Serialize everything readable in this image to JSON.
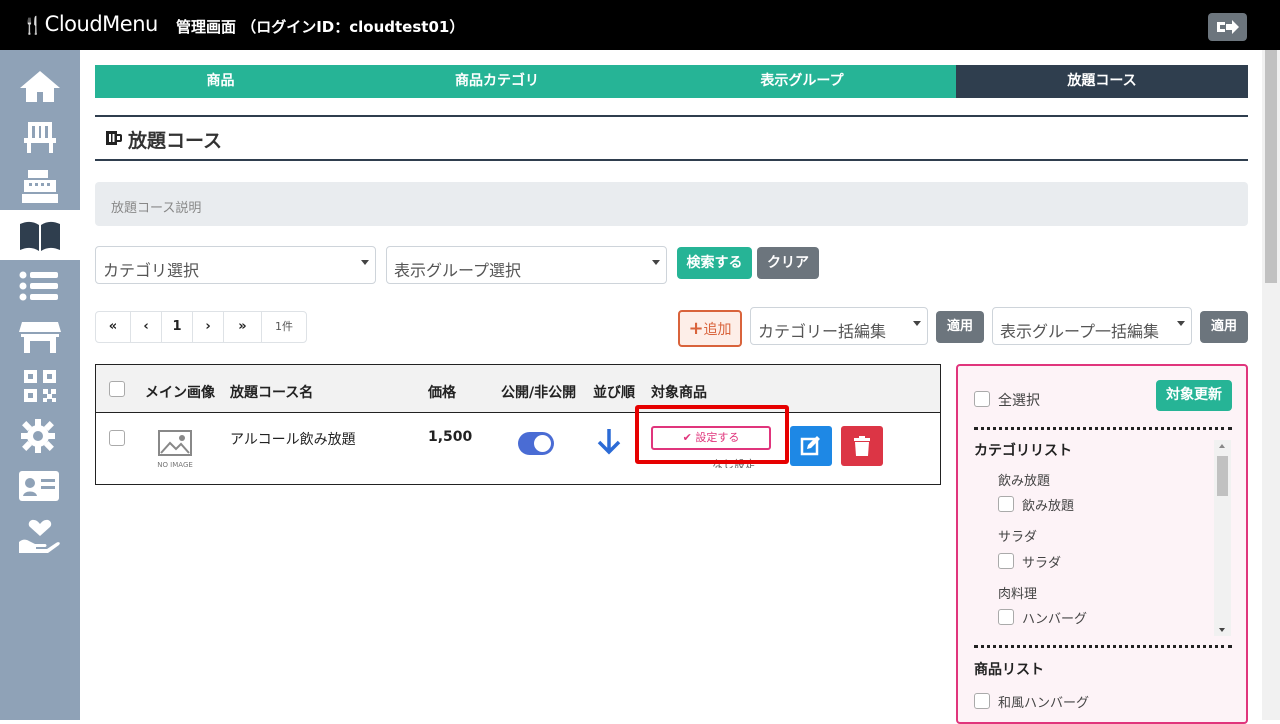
{
  "header": {
    "logo_text": "CloudMenu",
    "title": "管理画面 （ログインID：cloudtest01）"
  },
  "tabs": [
    {
      "label": "商品"
    },
    {
      "label": "商品カテゴリ"
    },
    {
      "label": "表示グループ"
    },
    {
      "label": "放題コース",
      "active": true
    }
  ],
  "page": {
    "title": "放題コース",
    "description_placeholder": "放題コース説明"
  },
  "filters": {
    "category_select": "カテゴリ選択",
    "display_group_select": "表示グループ選択",
    "search_label": "検索する",
    "clear_label": "クリア"
  },
  "pager": {
    "first": "«",
    "prev": "‹",
    "current": "1",
    "next": "›",
    "last": "»",
    "count": "1件"
  },
  "bulk": {
    "add_label": "追加",
    "category_bulk": "カテゴリー括編集",
    "apply1": "適用",
    "group_bulk": "表示グループ一括編集",
    "apply2": "適用"
  },
  "table": {
    "headers": [
      "メイン画像",
      "放題コース名",
      "価格",
      "公開/非公開",
      "並び順",
      "対象商品"
    ],
    "rows": [
      {
        "no_image": "NO IMAGE",
        "name": "アルコール飲み放題",
        "price": "1,500",
        "published": true,
        "set_label": "設定する",
        "sub_text": "なし設定"
      }
    ]
  },
  "panel": {
    "select_all": "全選択",
    "update_label": "対象更新",
    "category_list_title": "カテゴリリスト",
    "categories": [
      {
        "name": "飲み放題",
        "item": "飲み放題"
      },
      {
        "name": "サラダ",
        "item": "サラダ"
      },
      {
        "name": "肉料理",
        "item": "ハンバーグ"
      }
    ],
    "product_list_title": "商品リスト",
    "products": [
      "和風ハンバーグ"
    ]
  },
  "colors": {
    "accent": "#26b496",
    "dark": "#2f3e4e",
    "highlight": "#e60000",
    "pink": "#e0357c",
    "sidebar": "#8fa2b7"
  },
  "sidebar_icons": [
    "home-icon",
    "chair-icon",
    "register-icon",
    "book-icon",
    "list-icon",
    "store-icon",
    "qr-code-icon",
    "gear-icon",
    "id-card-icon",
    "heart-hand-icon"
  ]
}
